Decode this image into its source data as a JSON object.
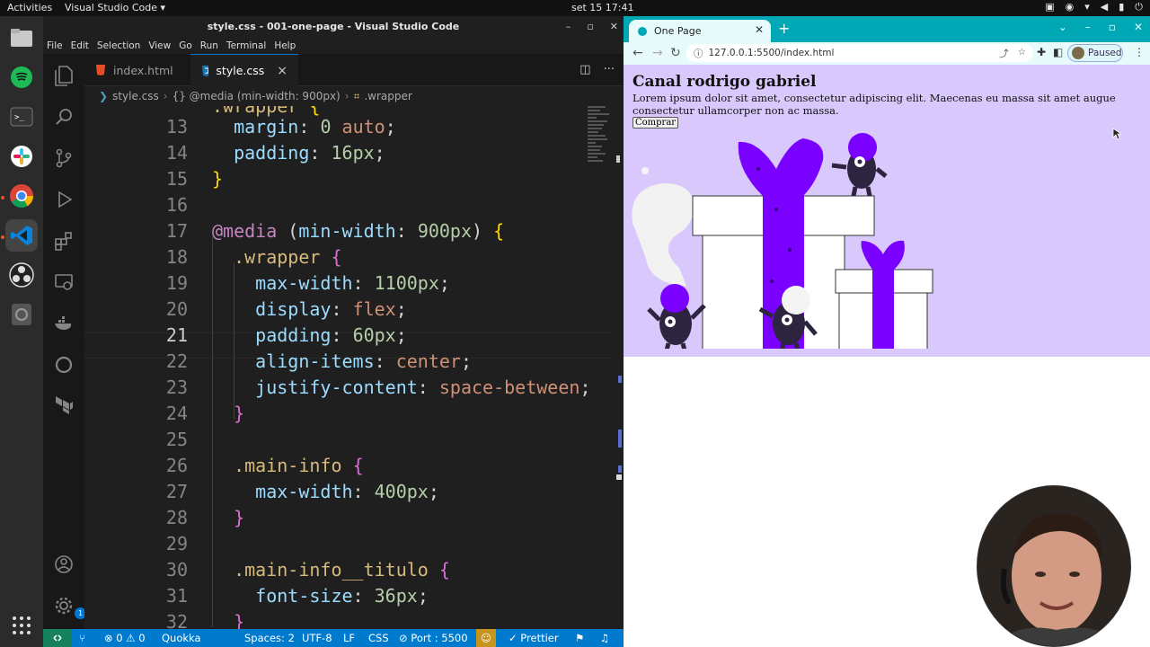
{
  "system": {
    "activities": "Activities",
    "app_menu": "Visual Studio Code ▾",
    "clock": "set 15  17:41"
  },
  "vscode": {
    "title": "style.css - 001-one-page - Visual Studio Code",
    "menu": [
      "File",
      "Edit",
      "Selection",
      "View",
      "Go",
      "Run",
      "Terminal",
      "Help"
    ],
    "tabs": [
      {
        "label": "index.html",
        "icon": "html-file-icon"
      },
      {
        "label": "style.css",
        "icon": "css-file-icon"
      }
    ],
    "tab_close": "×",
    "breadcrumb": [
      "style.css",
      "{} @media (min-width: 900px)",
      ".wrapper"
    ],
    "current_line": 21,
    "line_numbers": [
      "13",
      "14",
      "15",
      "16",
      "17",
      "18",
      "19",
      "20",
      "21",
      "22",
      "23",
      "24",
      "25",
      "26",
      "27",
      "28",
      "29",
      "30",
      "31",
      "32"
    ],
    "settings_badge": "1",
    "status": {
      "problems": "⊗ 0 ⚠ 0",
      "quokka": "Quokka",
      "spaces": "Spaces: 2",
      "encoding": "UTF-8",
      "eol": "LF",
      "language": "CSS",
      "port": "⊘ Port : 5500",
      "prettier": "✓ Prettier"
    }
  },
  "browser": {
    "tab_title": "One Page",
    "url": "127.0.0.1:5500/index.html",
    "profile_status": "Paused",
    "page": {
      "heading": "Canal rodrigo gabriel",
      "paragraph": "Lorem ipsum dolor sit amet, consectetur adipiscing elit. Maecenas eu massa sit amet augue consectetur ullamcorper non ac massa.",
      "button": "Comprar"
    }
  },
  "colors": {
    "hero_bg": "#d8c8fb",
    "gift_ribbon": "#7a00ff",
    "status_bar": "#007acc",
    "chrome_accent": "#00a8b5"
  }
}
